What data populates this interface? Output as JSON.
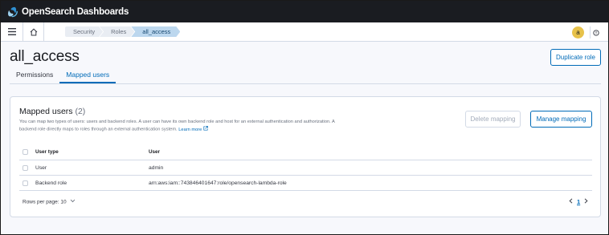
{
  "app": {
    "brand": "OpenSearch Dashboards"
  },
  "nav": {
    "breadcrumbs": [
      "Security",
      "Roles",
      "all_access"
    ],
    "user_initial": "a"
  },
  "page": {
    "title": "all_access",
    "duplicate_label": "Duplicate role",
    "tabs": [
      "Permissions",
      "Mapped users"
    ],
    "selected_tab": "Mapped users"
  },
  "panel": {
    "title": "Mapped users",
    "count": "(2)",
    "description": "You can map two types of users: users and backend roles. A user can have its own backend role and host for an external authentication and authorization. A backend role directly maps to roles through an external authentication system.",
    "learn_more": "Learn more",
    "delete_label": "Delete mapping",
    "manage_label": "Manage mapping"
  },
  "table": {
    "columns": [
      "User type",
      "User"
    ],
    "rows": [
      {
        "type": "User",
        "user": "admin"
      },
      {
        "type": "Backend role",
        "user": "arn:aws:iam::743846401647:role/opensearch-lambda-role"
      }
    ]
  },
  "pagination": {
    "rows_per_page_label": "Rows per page: 10",
    "current_page": "1"
  },
  "colors": {
    "header_bg": "#1a1c21",
    "accent": "#006bb8",
    "avatar": "#e7c24a",
    "active_crumb": "#bcd7ee"
  }
}
